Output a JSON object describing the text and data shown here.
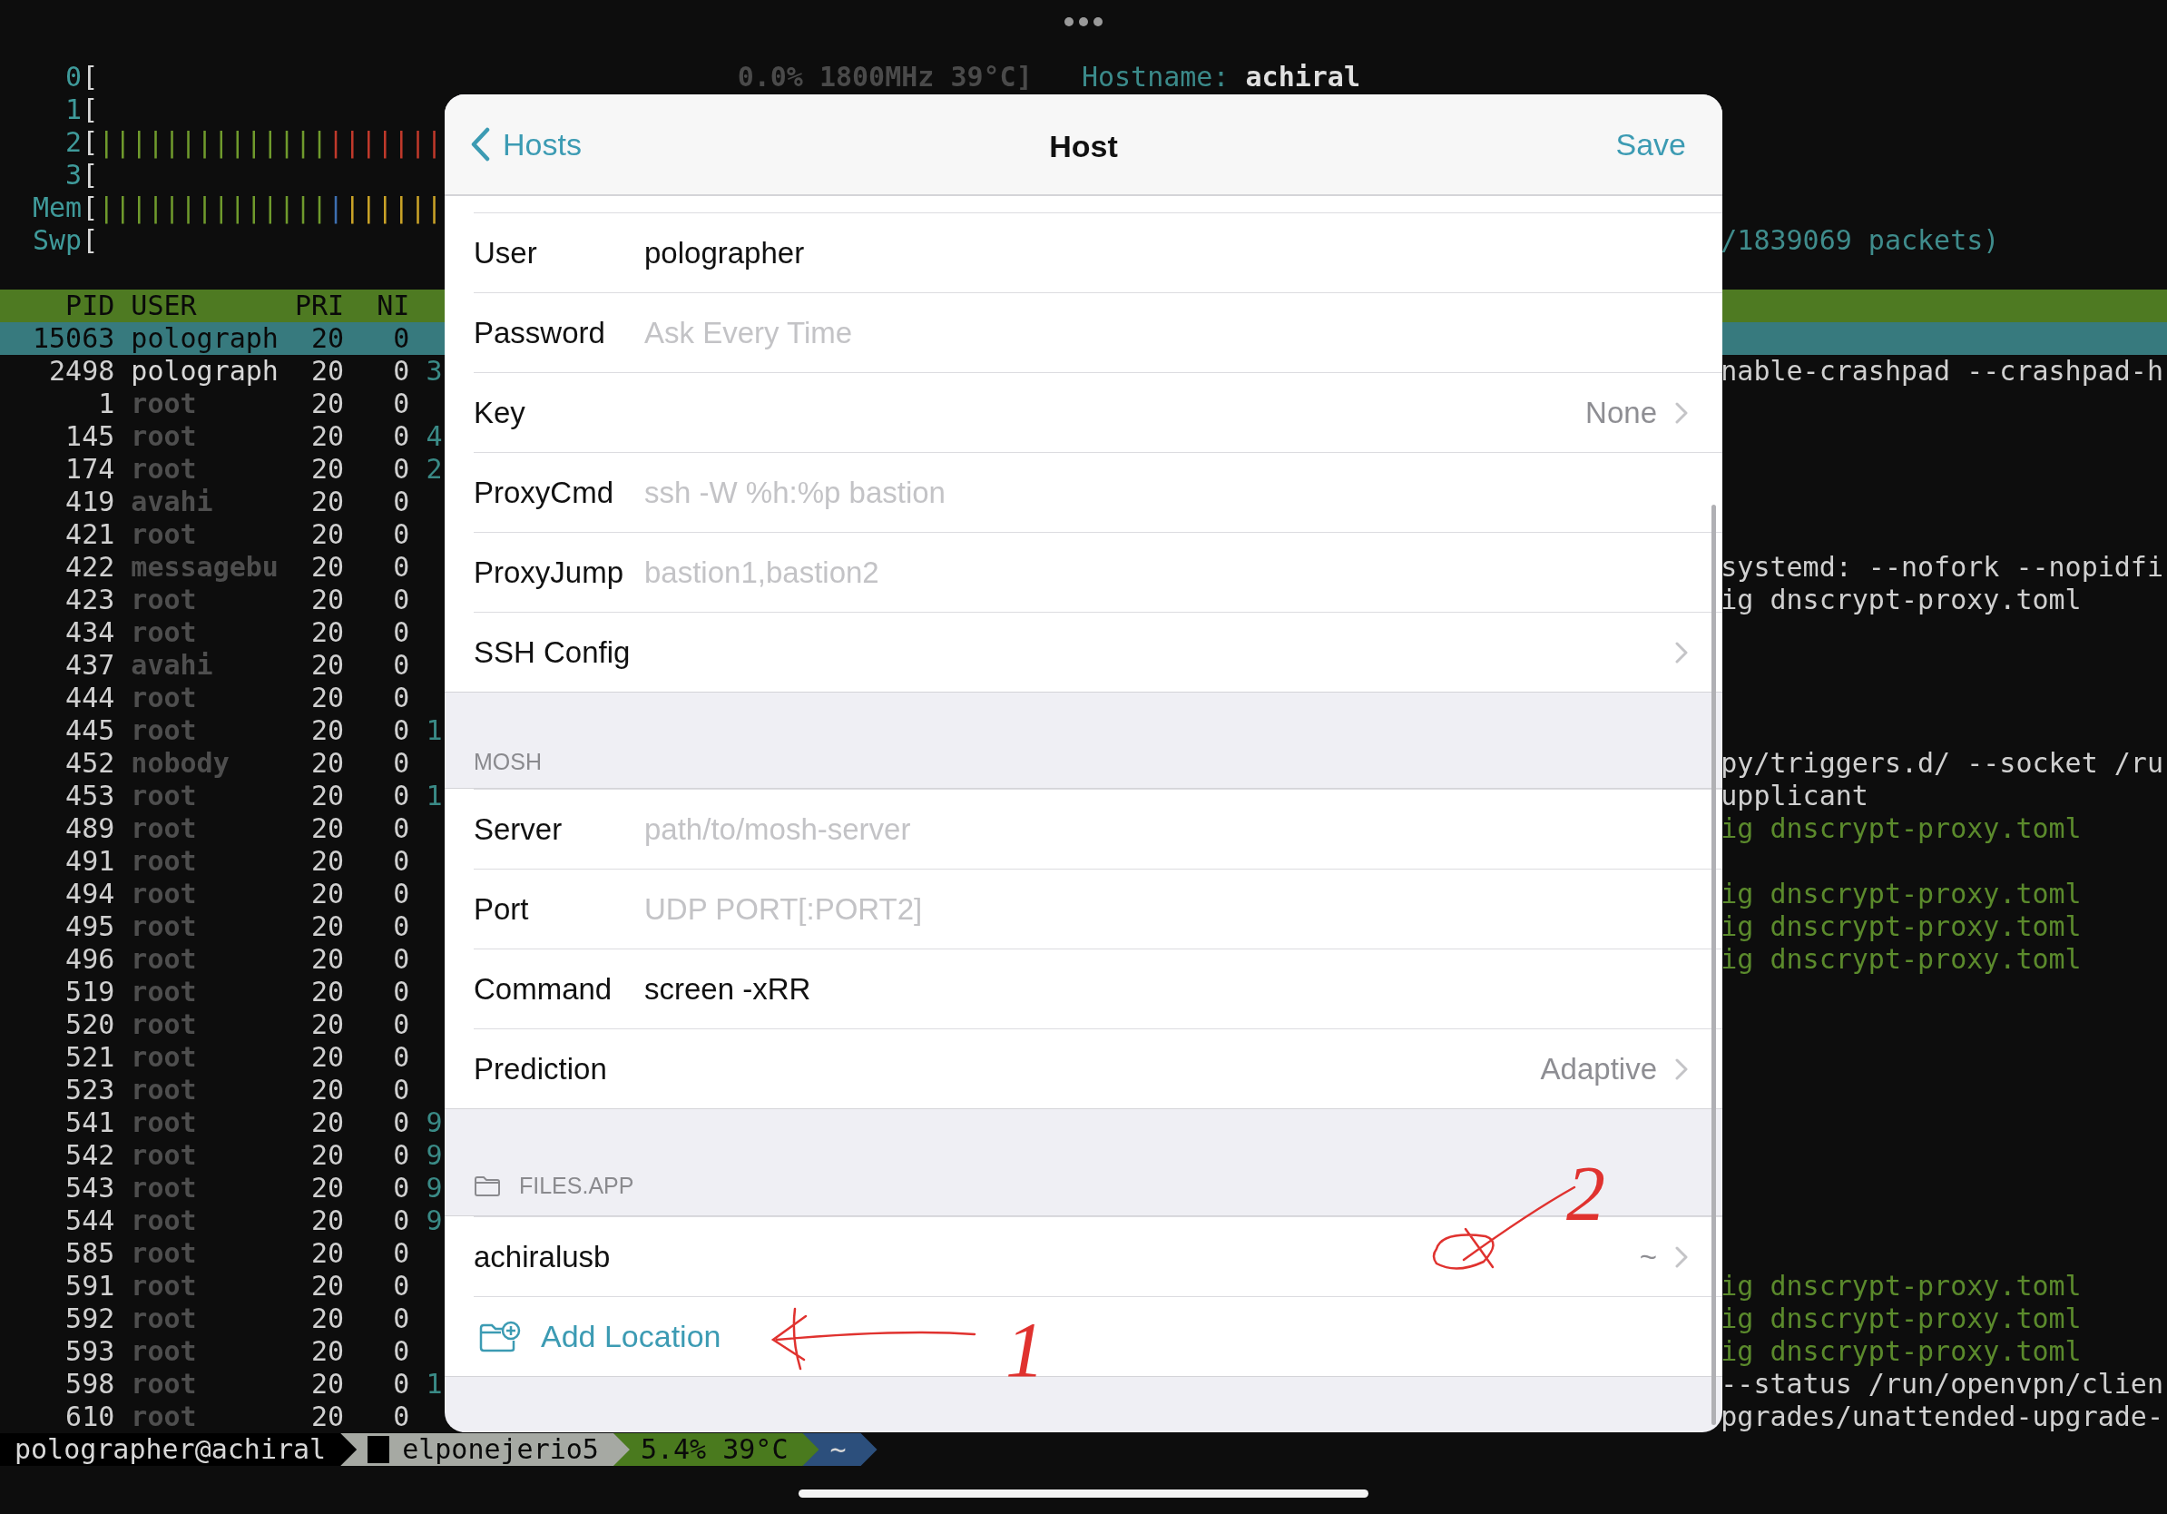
{
  "terminal": {
    "meters": [
      {
        "label": "0",
        "bracket": "[",
        "cpu_reading": "0.0% 1800MHz 39°C]",
        "hostname_label": "Hostname:",
        "hostname": "achiral"
      },
      {
        "label": "1",
        "bracket": "["
      },
      {
        "label": "2",
        "bracket": "[",
        "segments": [
          {
            "text": "||||||||||||||",
            "color": "#6f9a2c"
          },
          {
            "text": "|||||||",
            "color": "#c0392b"
          }
        ]
      },
      {
        "label": "3",
        "bracket": "["
      },
      {
        "label": "Mem",
        "bracket": "[",
        "segments": [
          {
            "text": "||||||||||||||",
            "color": "#6f9a2c"
          },
          {
            "text": "|",
            "color": "#3d6fb0"
          },
          {
            "text": "||||||",
            "color": "#c9a227"
          }
        ]
      },
      {
        "label": "Swp",
        "bracket": "[",
        "right_text": "/1839069 packets)"
      }
    ],
    "columns": [
      "PID",
      "USER",
      "PRI",
      "NI"
    ],
    "processes": [
      {
        "pid": "15063",
        "user": "polograph",
        "pri": "20",
        "ni": "0",
        "dimmed": false,
        "selected": true
      },
      {
        "pid": "2498",
        "user": "polograph",
        "pri": "20",
        "ni": "0",
        "virt": "3",
        "dimmed": false,
        "selected": false,
        "command": {
          "text": "nable-crashpad --crashpad-h",
          "thread": false
        }
      },
      {
        "pid": "1",
        "user": "root",
        "pri": "20",
        "ni": "0",
        "dimmed": true,
        "selected": false
      },
      {
        "pid": "145",
        "user": "root",
        "pri": "20",
        "ni": "0",
        "virt": "4",
        "dimmed": true,
        "selected": false
      },
      {
        "pid": "174",
        "user": "root",
        "pri": "20",
        "ni": "0",
        "virt": "2",
        "dimmed": true,
        "selected": false
      },
      {
        "pid": "419",
        "user": "avahi",
        "pri": "20",
        "ni": "0",
        "dimmed": true,
        "selected": false
      },
      {
        "pid": "421",
        "user": "root",
        "pri": "20",
        "ni": "0",
        "dimmed": true,
        "selected": false
      },
      {
        "pid": "422",
        "user": "messagebu",
        "pri": "20",
        "ni": "0",
        "dimmed": true,
        "selected": false,
        "command": {
          "text": "systemd: --nofork --nopidfi",
          "thread": false
        }
      },
      {
        "pid": "423",
        "user": "root",
        "pri": "20",
        "ni": "0",
        "dimmed": true,
        "selected": false,
        "command": {
          "text": "ig dnscrypt-proxy.toml",
          "thread": false
        }
      },
      {
        "pid": "434",
        "user": "root",
        "pri": "20",
        "ni": "0",
        "dimmed": true,
        "selected": false
      },
      {
        "pid": "437",
        "user": "avahi",
        "pri": "20",
        "ni": "0",
        "dimmed": true,
        "selected": false
      },
      {
        "pid": "444",
        "user": "root",
        "pri": "20",
        "ni": "0",
        "dimmed": true,
        "selected": false
      },
      {
        "pid": "445",
        "user": "root",
        "pri": "20",
        "ni": "0",
        "virt": "1",
        "dimmed": true,
        "selected": false
      },
      {
        "pid": "452",
        "user": "nobody",
        "pri": "20",
        "ni": "0",
        "dimmed": true,
        "selected": false,
        "command": {
          "text": "py/triggers.d/ --socket /ru",
          "thread": false
        }
      },
      {
        "pid": "453",
        "user": "root",
        "pri": "20",
        "ni": "0",
        "virt": "1",
        "dimmed": true,
        "selected": false,
        "command": {
          "text": "upplicant",
          "thread": false
        }
      },
      {
        "pid": "489",
        "user": "root",
        "pri": "20",
        "ni": "0",
        "dimmed": true,
        "selected": false,
        "command": {
          "text": "ig dnscrypt-proxy.toml",
          "thread": true
        }
      },
      {
        "pid": "491",
        "user": "root",
        "pri": "20",
        "ni": "0",
        "dimmed": true,
        "selected": false
      },
      {
        "pid": "494",
        "user": "root",
        "pri": "20",
        "ni": "0",
        "dimmed": true,
        "selected": false,
        "command": {
          "text": "ig dnscrypt-proxy.toml",
          "thread": true
        }
      },
      {
        "pid": "495",
        "user": "root",
        "pri": "20",
        "ni": "0",
        "dimmed": true,
        "selected": false,
        "command": {
          "text": "ig dnscrypt-proxy.toml",
          "thread": true
        }
      },
      {
        "pid": "496",
        "user": "root",
        "pri": "20",
        "ni": "0",
        "dimmed": true,
        "selected": false,
        "command": {
          "text": "ig dnscrypt-proxy.toml",
          "thread": true
        }
      },
      {
        "pid": "519",
        "user": "root",
        "pri": "20",
        "ni": "0",
        "dimmed": true,
        "selected": false
      },
      {
        "pid": "520",
        "user": "root",
        "pri": "20",
        "ni": "0",
        "dimmed": true,
        "selected": false
      },
      {
        "pid": "521",
        "user": "root",
        "pri": "20",
        "ni": "0",
        "dimmed": true,
        "selected": false
      },
      {
        "pid": "523",
        "user": "root",
        "pri": "20",
        "ni": "0",
        "dimmed": true,
        "selected": false
      },
      {
        "pid": "541",
        "user": "root",
        "pri": "20",
        "ni": "0",
        "virt": "9",
        "dimmed": true,
        "selected": false
      },
      {
        "pid": "542",
        "user": "root",
        "pri": "20",
        "ni": "0",
        "virt": "9",
        "dimmed": true,
        "selected": false
      },
      {
        "pid": "543",
        "user": "root",
        "pri": "20",
        "ni": "0",
        "virt": "9",
        "dimmed": true,
        "selected": false
      },
      {
        "pid": "544",
        "user": "root",
        "pri": "20",
        "ni": "0",
        "virt": "9",
        "dimmed": true,
        "selected": false
      },
      {
        "pid": "585",
        "user": "root",
        "pri": "20",
        "ni": "0",
        "dimmed": true,
        "selected": false
      },
      {
        "pid": "591",
        "user": "root",
        "pri": "20",
        "ni": "0",
        "dimmed": true,
        "selected": false,
        "command": {
          "text": "ig dnscrypt-proxy.toml",
          "thread": true
        }
      },
      {
        "pid": "592",
        "user": "root",
        "pri": "20",
        "ni": "0",
        "dimmed": true,
        "selected": false,
        "command": {
          "text": "ig dnscrypt-proxy.toml",
          "thread": true
        }
      },
      {
        "pid": "593",
        "user": "root",
        "pri": "20",
        "ni": "0",
        "dimmed": true,
        "selected": false,
        "command": {
          "text": "ig dnscrypt-proxy.toml",
          "thread": true
        }
      },
      {
        "pid": "598",
        "user": "root",
        "pri": "20",
        "ni": "0",
        "virt": "1",
        "dimmed": true,
        "selected": false,
        "command": {
          "text": "--status /run/openvpn/clien",
          "thread": false
        }
      },
      {
        "pid": "610",
        "user": "root",
        "pri": "20",
        "ni": "0",
        "dimmed": true,
        "selected": false,
        "command": {
          "text": "pgrades/unattended-upgrade-",
          "thread": false
        }
      }
    ],
    "status_line": [
      {
        "text": "polographer@achiral",
        "color": "#000000",
        "cursor": false
      },
      {
        "text": "elponejerio5",
        "color": "#a6a9a3",
        "cursor": true
      },
      {
        "text": "5.4% 39°C",
        "color": "#4a7a1e",
        "cursor": false
      },
      {
        "text": "~",
        "color": "#2c4f7c",
        "cursor": false
      }
    ]
  },
  "dialog": {
    "back": "Hosts",
    "title": "Host",
    "action": "Save",
    "sections": [
      {
        "kind": "plain",
        "rows": [
          {
            "kind": "field",
            "label": "User",
            "value": "polographer"
          },
          {
            "kind": "field",
            "label": "Password",
            "placeholder": "Ask Every Time"
          },
          {
            "kind": "disclosure",
            "label": "Key",
            "detail": "None"
          },
          {
            "kind": "field",
            "label": "ProxyCmd",
            "placeholder": "ssh -W %h:%p bastion"
          },
          {
            "kind": "field",
            "label": "ProxyJump",
            "placeholder": "bastion1,bastion2"
          },
          {
            "kind": "disclosure",
            "label": "SSH Config"
          }
        ]
      },
      {
        "kind": "plain",
        "header": "MOSH",
        "rows": [
          {
            "kind": "field",
            "label": "Server",
            "placeholder": "path/to/mosh-server"
          },
          {
            "kind": "field",
            "label": "Port",
            "placeholder": "UDP PORT[:PORT2]"
          },
          {
            "kind": "field",
            "label": "Command",
            "value": "screen -xRR"
          },
          {
            "kind": "disclosure",
            "label": "Prediction",
            "detail": "Adaptive"
          }
        ]
      },
      {
        "kind": "files",
        "header": "FILES.APP",
        "rows": [
          {
            "kind": "disclosure",
            "label": "achiralusb",
            "detail": "~"
          },
          {
            "kind": "action",
            "label": "Add Location"
          }
        ]
      }
    ]
  },
  "annotations": [
    {
      "label": "2"
    },
    {
      "label": "1"
    }
  ]
}
